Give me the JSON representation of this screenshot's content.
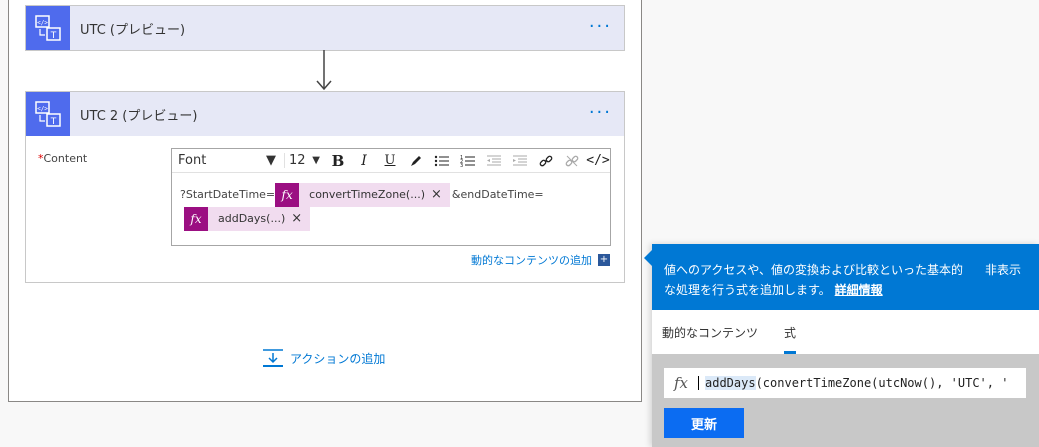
{
  "card1": {
    "title": "UTC (プレビュー)",
    "more": "···"
  },
  "card2": {
    "title": "UTC 2 (プレビュー)",
    "more": "···",
    "field_required": "*",
    "field_label": "Content",
    "toolbar": {
      "font": "Font",
      "size": "12",
      "bold": "B",
      "italic": "I",
      "underline": "U"
    },
    "content": {
      "prefix": "?StartDateTime=",
      "token1": "convertTimeZone(...)",
      "middle": "&endDateTime=",
      "token2": "addDays(...)",
      "token_remove": "×",
      "fx": "fx"
    },
    "dynamic_link": "動的なコンテンツの追加"
  },
  "add_action": "アクションの追加",
  "panel": {
    "header_text": "値へのアクセスや、値の変換および比較といった基本的な処理を行う式を追加します。",
    "learn_more": "詳細情報",
    "hide": "非表示",
    "tabs": [
      {
        "label": "動的なコンテンツ",
        "active": false
      },
      {
        "label": "式",
        "active": true
      }
    ],
    "expression_fx": "fx",
    "expression_func": "addDays",
    "expression_rest": "(convertTimeZone(utcNow(), 'UTC', '",
    "update_button": "更新"
  },
  "colors": {
    "accent": "#0078d4",
    "token_fx": "#9b0f82",
    "token_bg": "#f1dcef",
    "card_icon": "#4f6bed",
    "card_head": "#e6e8f6"
  }
}
